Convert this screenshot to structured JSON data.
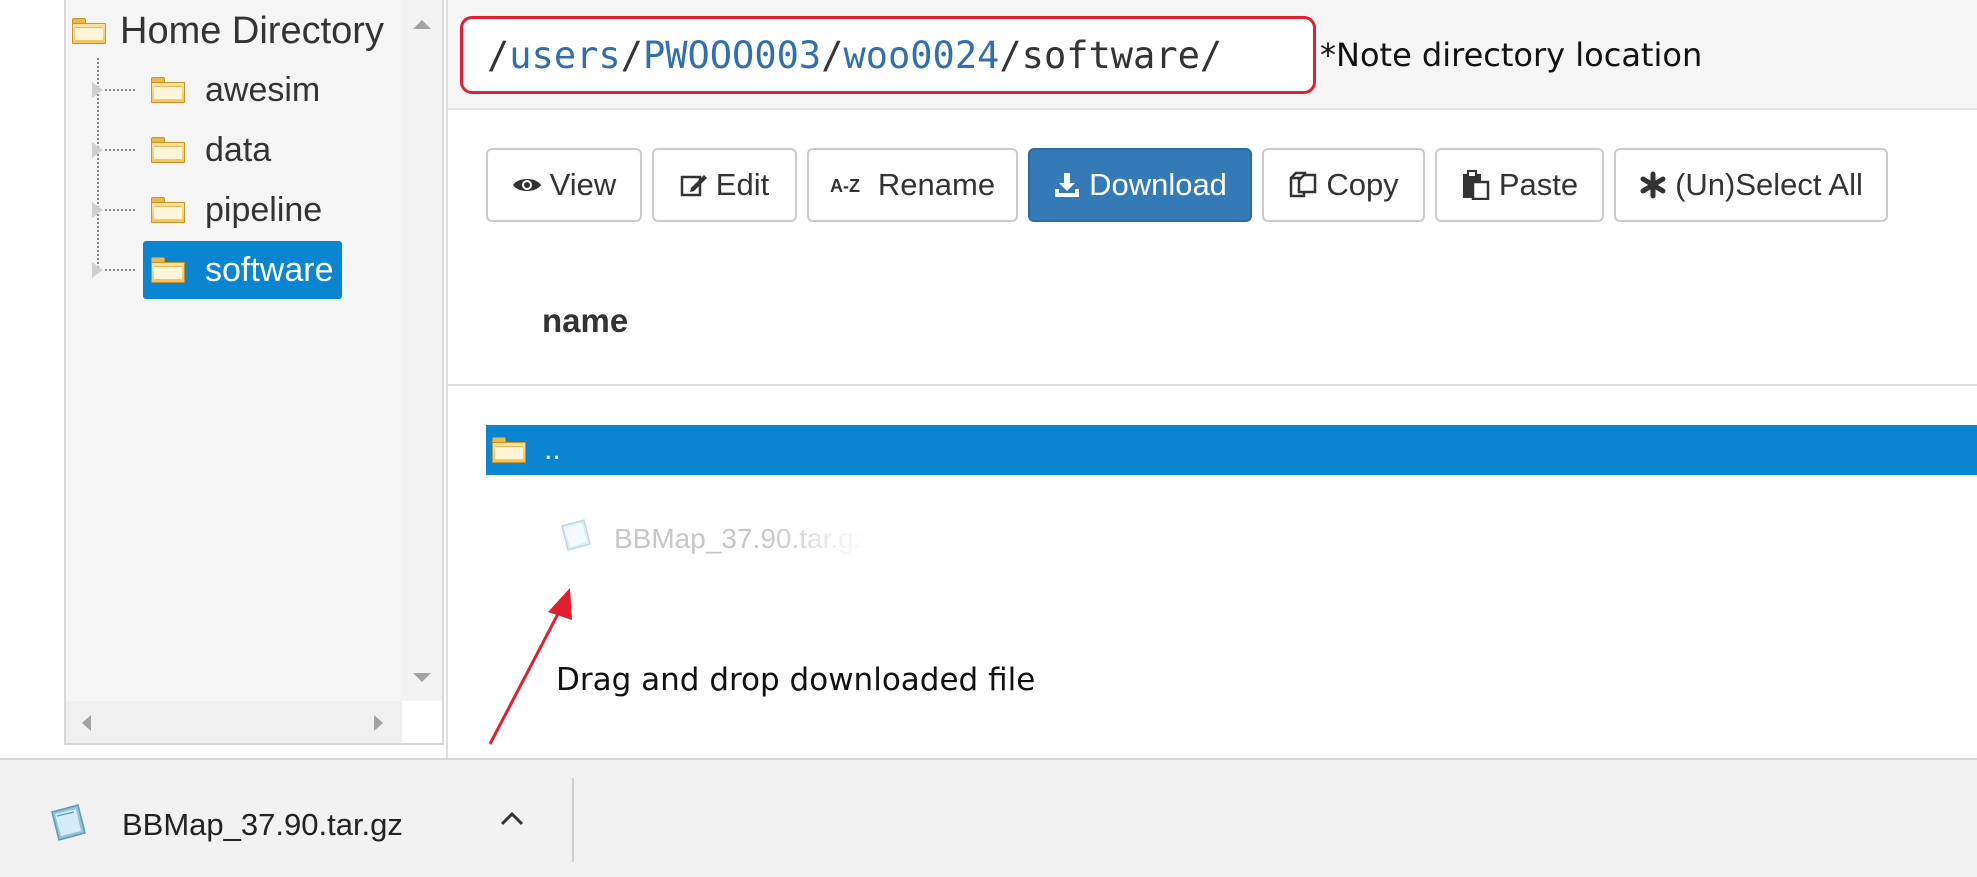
{
  "tree": {
    "root_label": "Home Directory",
    "items": [
      {
        "label": "awesim",
        "selected": false
      },
      {
        "label": "data",
        "selected": false
      },
      {
        "label": "pipeline",
        "selected": false
      },
      {
        "label": "software",
        "selected": true
      }
    ]
  },
  "path": {
    "segments": [
      "users",
      "PWOOO003",
      "woo0024"
    ],
    "current": "software",
    "note": "*Note directory location"
  },
  "toolbar": {
    "view_label": "View",
    "edit_label": "Edit",
    "rename_label": "Rename",
    "download_label": "Download",
    "copy_label": "Copy",
    "paste_label": "Paste",
    "select_all_label": "(Un)Select All"
  },
  "table": {
    "column_header": "name",
    "parent_row_label": ".."
  },
  "drag": {
    "file_name": "BBMap_37.90.tar.gz",
    "caption": "Drag and drop downloaded file"
  },
  "downloads": {
    "file_name": "BBMap_37.90.tar.gz"
  },
  "colors": {
    "selection_blue": "#0a85d2",
    "primary_button": "#337ab7",
    "annotation_red": "#e0202e"
  }
}
